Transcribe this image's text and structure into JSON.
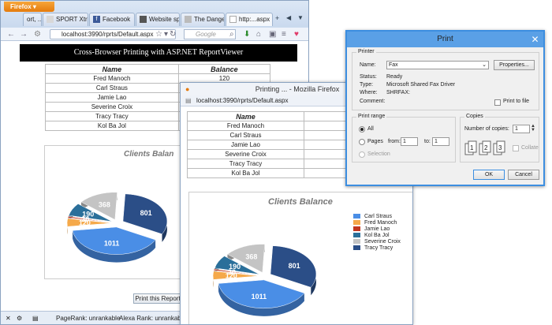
{
  "firefox": {
    "menu_button": "Firefox",
    "tabs": [
      {
        "label": "ort, ...",
        "icon": "page-icon"
      },
      {
        "label": "SPORT Xtre",
        "icon": "page-icon"
      },
      {
        "label": "Facebook",
        "icon": "facebook-icon"
      },
      {
        "label": "Website spe",
        "icon": "page-icon"
      },
      {
        "label": "The Danger",
        "icon": "page-icon"
      },
      {
        "label": "http:...aspx",
        "icon": "page-icon"
      }
    ],
    "url": "localhost:3990/rprts/Default.aspx",
    "search_placeholder": "Google",
    "status": {
      "pagerank1": "PageRank: unrankable",
      "alexa": "Alexa Rank: unrankable"
    }
  },
  "report": {
    "header": "Cross-Browser Printing with ASP.NET ReportViewer",
    "col_name": "Name",
    "col_balance": "Balance",
    "rows": [
      {
        "name": "Fred Manoch",
        "balance": "120"
      },
      {
        "name": "Carl Straus",
        "balance": ""
      },
      {
        "name": "Jamie Lao",
        "balance": ""
      },
      {
        "name": "Severine Croix",
        "balance": ""
      },
      {
        "name": "Tracy Tracy",
        "balance": ""
      },
      {
        "name": "Kol Ba Jol",
        "balance": ""
      }
    ],
    "chart_title_clipped": "Clients Balan",
    "print_button": "Print this Report"
  },
  "printing_window": {
    "title": "Printing ... - Mozilla Firefox",
    "url": "localhost:3990/rprts/Default.aspx",
    "col_name": "Name",
    "col_balance_clipped": "B",
    "rows": [
      "Fred Manoch",
      "Carl Straus",
      "Jamie Lao",
      "Severine Croix",
      "Tracy Tracy",
      "Kol Ba Jol"
    ],
    "chart_title": "Clients Balance"
  },
  "chart_data": {
    "type": "pie",
    "title": "Clients Balance",
    "categories": [
      "Carl Straus",
      "Fred Manoch",
      "Jamie Lao",
      "Kol Ba Jol",
      "Severine Croix",
      "Tracy Tracy"
    ],
    "values": [
      1011,
      120,
      20,
      190,
      368,
      801
    ],
    "colors": [
      "#4a8ee6",
      "#f5a94a",
      "#c2371f",
      "#2a6f9a",
      "#c4c4c4",
      "#2b4e87"
    ]
  },
  "print_dialog": {
    "title": "Print",
    "close": "✕",
    "printer_group": "Printer",
    "name_label": "Name:",
    "name_value": "Fax",
    "properties_button": "Properties...",
    "status_label": "Status:",
    "status_value": "Ready",
    "type_label": "Type:",
    "type_value": "Microsoft Shared Fax Driver",
    "where_label": "Where:",
    "where_value": "SHRFAX:",
    "comment_label": "Comment:",
    "print_to_file": "Print to file",
    "range_group": "Print range",
    "all_label": "All",
    "pages_label": "Pages",
    "from_label": "from:",
    "from_value": "1",
    "to_label": "to:",
    "to_value": "1",
    "selection_label": "Selection",
    "copies_group": "Copies",
    "num_copies_label": "Number of copies:",
    "num_copies_value": "1",
    "collate_label": "Collate",
    "ok_button": "OK",
    "cancel_button": "Cancel"
  }
}
